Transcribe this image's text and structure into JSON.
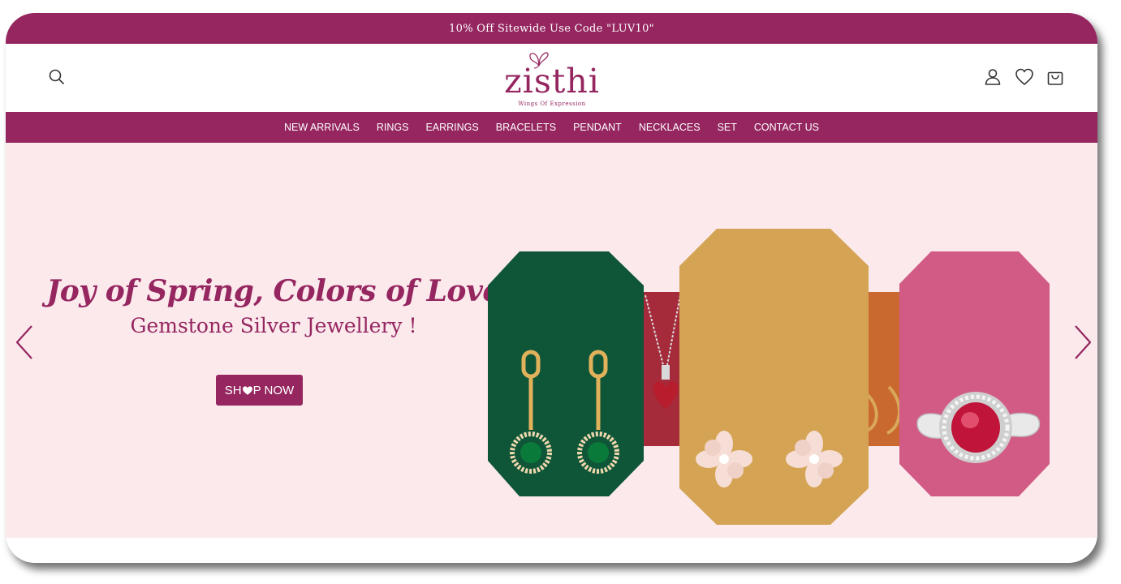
{
  "announcement": {
    "text": "10% Off Sitewide Use Code \"LUV10\""
  },
  "header": {
    "logo_name": "zisthi",
    "logo_tagline": "Wings Of Expression",
    "icons": {
      "search": "search-icon",
      "account": "user-icon",
      "wishlist": "heart-icon",
      "cart": "bag-icon"
    }
  },
  "nav": {
    "items": [
      {
        "label": "NEW ARRIVALS"
      },
      {
        "label": "RINGS"
      },
      {
        "label": "EARRINGS"
      },
      {
        "label": "BRACELETS"
      },
      {
        "label": "PENDANT"
      },
      {
        "label": "NECKLACES"
      },
      {
        "label": "SET"
      },
      {
        "label": "CONTACT US"
      }
    ]
  },
  "hero": {
    "headline": "Joy of Spring, Colors of Love",
    "subheadline": "Gemstone Silver Jewellery !",
    "cta_pre": "SH",
    "cta_post": "P NOW",
    "cta_icon": "heart-icon",
    "prev_icon": "chevron-left-icon",
    "next_icon": "chevron-right-icon"
  },
  "colors": {
    "brand": "#952660",
    "hero_bg": "#fbe9ec",
    "panel_green": "#0e5637",
    "panel_gold": "#d4a454",
    "panel_pink": "#d25b85",
    "panel_red": "#a52a3a",
    "panel_orange": "#c9692f"
  }
}
